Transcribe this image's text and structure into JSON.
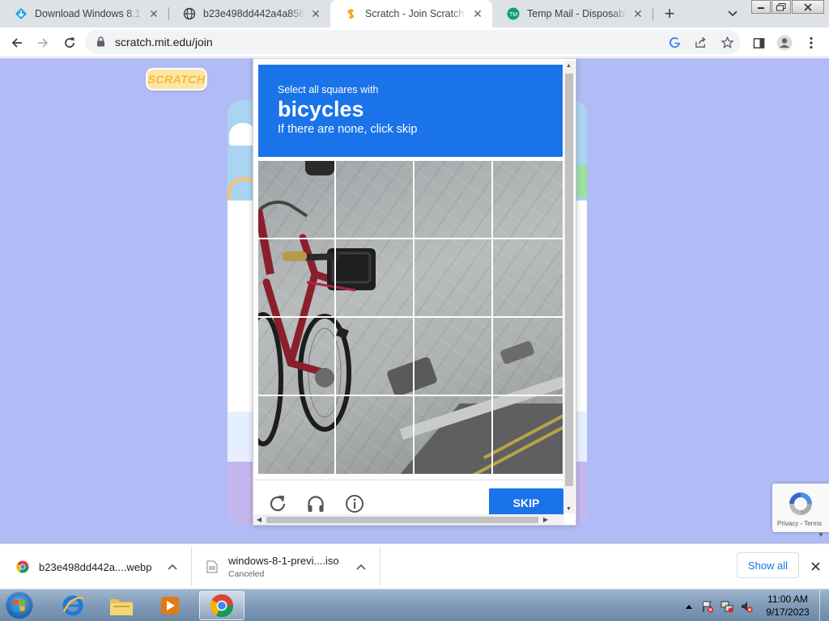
{
  "browser": {
    "tabs": [
      {
        "title": "Download Windows 8.1 64",
        "icon": "arrow-down-diamond-icon"
      },
      {
        "title": "b23e498dd442a4a85606f",
        "icon": "globe-icon"
      },
      {
        "title": "Scratch - Join Scratch",
        "icon": "scratch-favicon-icon"
      },
      {
        "title": "Temp Mail - Disposable Te",
        "icon": "tempmail-favicon-icon"
      }
    ],
    "address": "scratch.mit.edu/join"
  },
  "page": {
    "logo_text": "SCRATCH"
  },
  "captcha": {
    "instruction_small": "Select all squares with",
    "instruction_object": "bicycles",
    "instruction_hint": "If there are none, click skip",
    "skip_label": "SKIP",
    "grid": {
      "rows": 4,
      "cols": 4
    }
  },
  "recaptcha_badge": {
    "privacy": "Privacy",
    "sep": " - ",
    "terms": "Terms"
  },
  "downloads": [
    {
      "name": "b23e498dd442a....webp",
      "status": ""
    },
    {
      "name": "windows-8-1-previ....iso",
      "status": "Canceled"
    }
  ],
  "downloads_bar": {
    "show_all_label": "Show all"
  },
  "taskbar": {
    "time": "11:00 AM",
    "date": "9/17/2023"
  },
  "colors": {
    "captcha_blue": "#1a73e8",
    "page_bg": "#b1bcf7"
  }
}
